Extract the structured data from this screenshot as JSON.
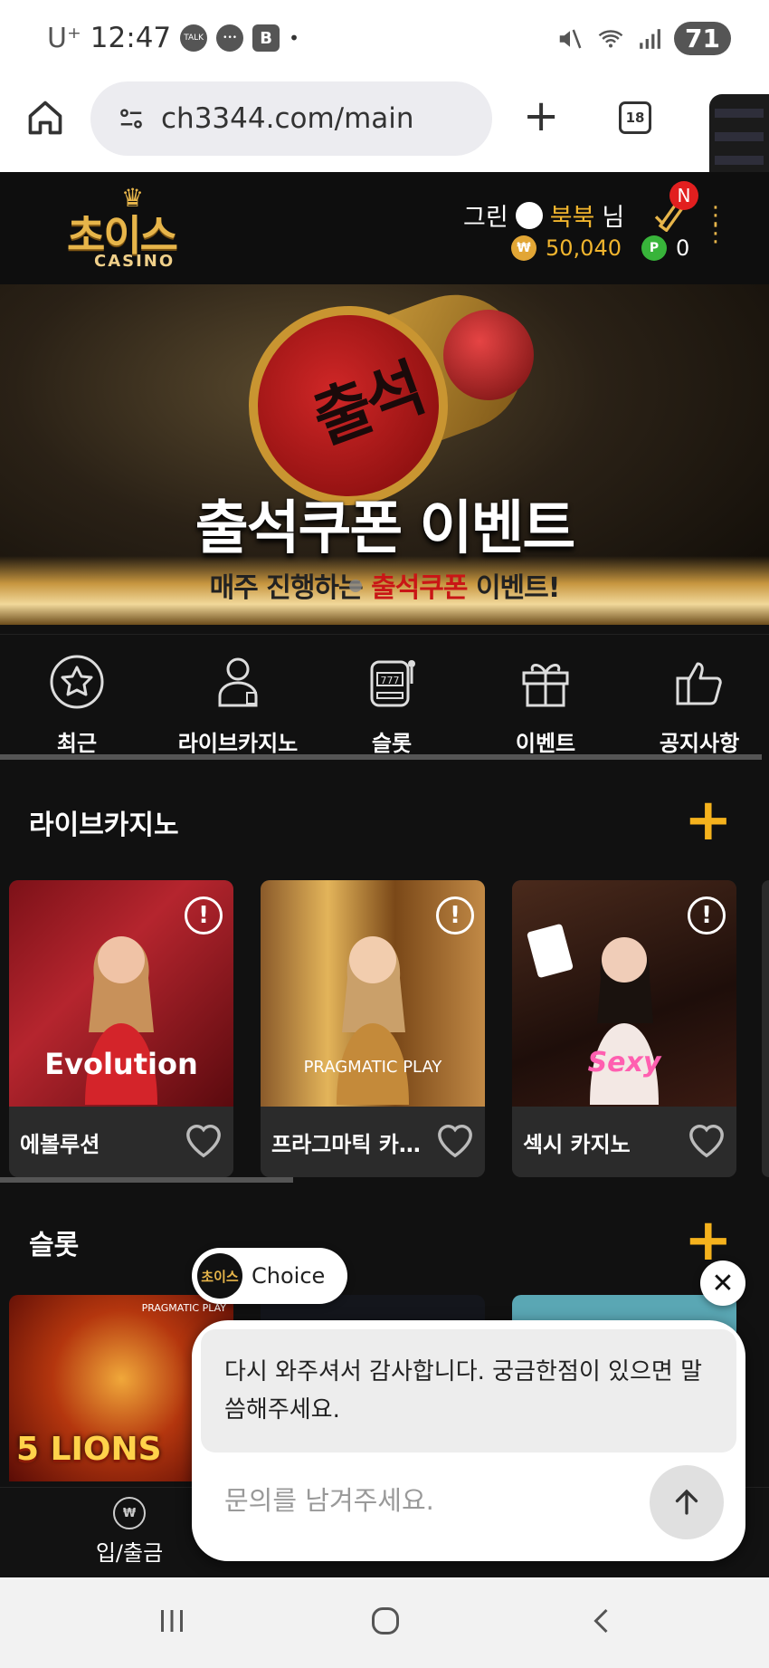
{
  "status_bar": {
    "carrier": "U⁺",
    "time": "12:47",
    "battery": "71",
    "talk_icon": "TALK",
    "b_icon": "B"
  },
  "browser": {
    "url": "ch3344.com/main",
    "tab_count": "18"
  },
  "header": {
    "logo_kr": "초이스",
    "logo_en": "CASINO",
    "user_prefix": "그린",
    "user_name": "북북",
    "user_suffix": "님",
    "coin_symbol": "₩",
    "balance": "50,040",
    "point_symbol": "P",
    "points": "0",
    "notification_badge": "N"
  },
  "banner": {
    "stamp_text": "출석",
    "title": "출석쿠폰 이벤트",
    "subtitle_pre": "매주 진행하는",
    "subtitle_highlight": "출석쿠폰",
    "subtitle_post": "이벤트!"
  },
  "categories": [
    {
      "label": "최근",
      "icon": "star-icon"
    },
    {
      "label": "라이브카지노",
      "icon": "dealer-icon"
    },
    {
      "label": "슬롯",
      "icon": "slot-machine-icon"
    },
    {
      "label": "이벤트",
      "icon": "gift-icon"
    },
    {
      "label": "공지사항",
      "icon": "thumbs-up-icon"
    }
  ],
  "live_section": {
    "title": "라이브카지노",
    "cards": [
      {
        "name": "에볼루션",
        "brand": "Evolution"
      },
      {
        "name": "프라그마틱 카…",
        "brand": "PRAGMATIC PLAY"
      },
      {
        "name": "섹시 카지노",
        "brand": "Sexy"
      }
    ]
  },
  "slot_section": {
    "title": "슬롯",
    "cards": [
      {
        "title": "5 LIONS",
        "provider": "PRAGMATIC PLAY"
      }
    ]
  },
  "bottom_nav": [
    {
      "label": "입/출금",
      "icon_text": "₩"
    }
  ],
  "chat": {
    "brand": "Choice",
    "avatar_text": "초이스",
    "message": "다시 와주셔서 감사합니다. 궁금한점이 있으면 말씀해주세요.",
    "input_placeholder": "문의를 남겨주세요."
  },
  "colors": {
    "accent": "#f5b21d",
    "gold": "#e7b54a",
    "badge_red": "#e21f1f",
    "point_green": "#38b43a"
  }
}
